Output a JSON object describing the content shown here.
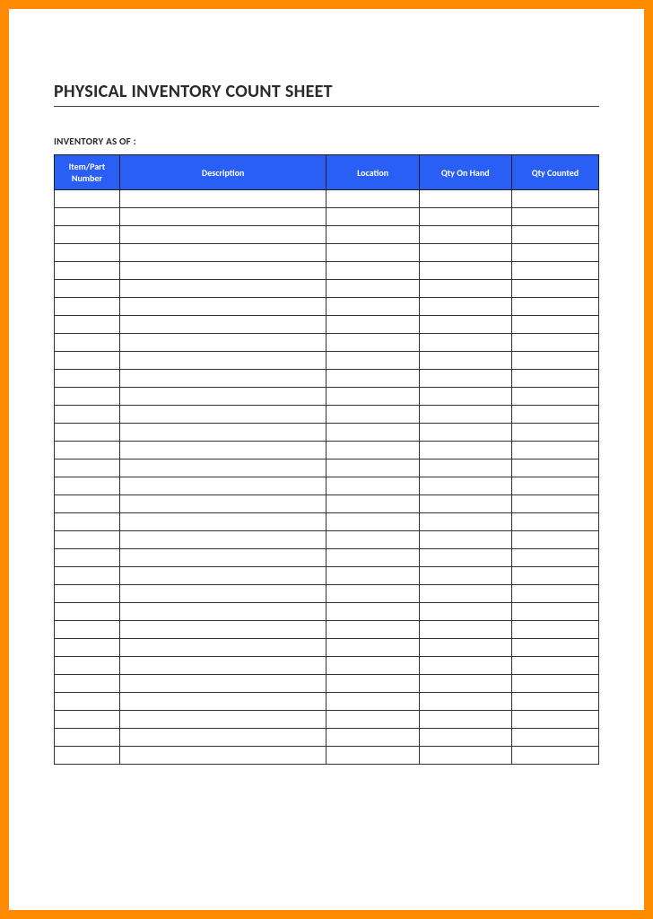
{
  "title": "PHYSICAL INVENTORY COUNT SHEET",
  "subtitle": "INVENTORY AS OF :",
  "columns": [
    "Item/Part Number",
    "Description",
    "Location",
    "Qty On Hand",
    "Qty Counted"
  ],
  "row_count": 32,
  "rows": [
    [
      "",
      "",
      "",
      "",
      ""
    ],
    [
      "",
      "",
      "",
      "",
      ""
    ],
    [
      "",
      "",
      "",
      "",
      ""
    ],
    [
      "",
      "",
      "",
      "",
      ""
    ],
    [
      "",
      "",
      "",
      "",
      ""
    ],
    [
      "",
      "",
      "",
      "",
      ""
    ],
    [
      "",
      "",
      "",
      "",
      ""
    ],
    [
      "",
      "",
      "",
      "",
      ""
    ],
    [
      "",
      "",
      "",
      "",
      ""
    ],
    [
      "",
      "",
      "",
      "",
      ""
    ],
    [
      "",
      "",
      "",
      "",
      ""
    ],
    [
      "",
      "",
      "",
      "",
      ""
    ],
    [
      "",
      "",
      "",
      "",
      ""
    ],
    [
      "",
      "",
      "",
      "",
      ""
    ],
    [
      "",
      "",
      "",
      "",
      ""
    ],
    [
      "",
      "",
      "",
      "",
      ""
    ],
    [
      "",
      "",
      "",
      "",
      ""
    ],
    [
      "",
      "",
      "",
      "",
      ""
    ],
    [
      "",
      "",
      "",
      "",
      ""
    ],
    [
      "",
      "",
      "",
      "",
      ""
    ],
    [
      "",
      "",
      "",
      "",
      ""
    ],
    [
      "",
      "",
      "",
      "",
      ""
    ],
    [
      "",
      "",
      "",
      "",
      ""
    ],
    [
      "",
      "",
      "",
      "",
      ""
    ],
    [
      "",
      "",
      "",
      "",
      ""
    ],
    [
      "",
      "",
      "",
      "",
      ""
    ],
    [
      "",
      "",
      "",
      "",
      ""
    ],
    [
      "",
      "",
      "",
      "",
      ""
    ],
    [
      "",
      "",
      "",
      "",
      ""
    ],
    [
      "",
      "",
      "",
      "",
      ""
    ],
    [
      "",
      "",
      "",
      "",
      ""
    ],
    [
      "",
      "",
      "",
      "",
      ""
    ]
  ]
}
